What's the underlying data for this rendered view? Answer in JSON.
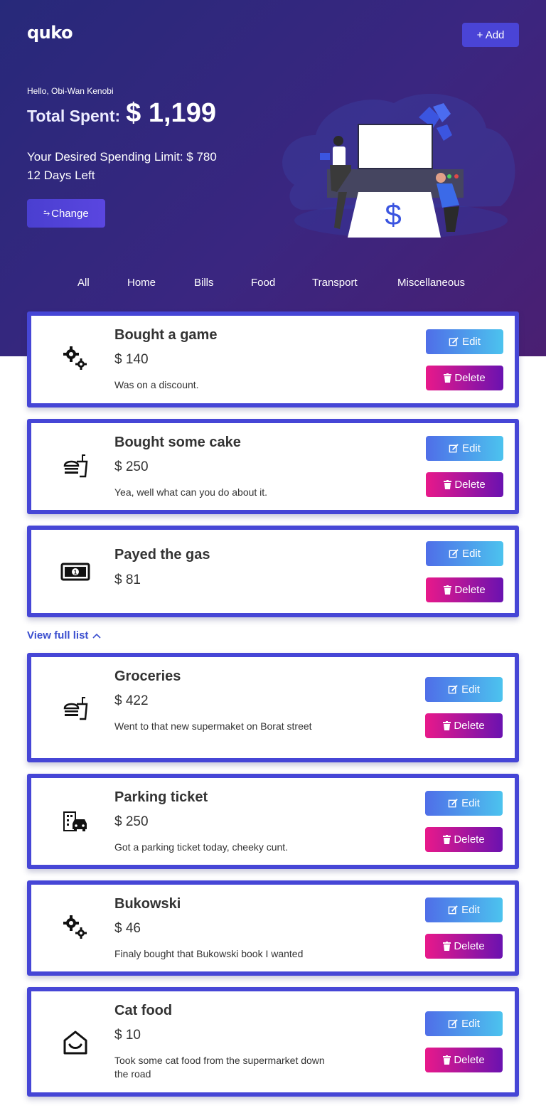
{
  "app": {
    "logo": "quko"
  },
  "header": {
    "add_label": "+ Add",
    "greeting": "Hello, Obi-Wan Kenobi",
    "total_label": "Total Spent:",
    "total_value": "$ 1,199",
    "limit_text": "Your Desired Spending Limit: $ 780",
    "days_left": "12 Days Left",
    "change_label": "Change",
    "illustration_symbol": "$"
  },
  "tabs": [
    "All",
    "Home",
    "Bills",
    "Food",
    "Transport",
    "Miscellaneous"
  ],
  "actions": {
    "edit_label": "Edit",
    "delete_label": "Delete"
  },
  "recent": [
    {
      "title": "Bought a game",
      "amount": "$ 140",
      "description": "Was on a discount.",
      "icon": "gears-icon"
    },
    {
      "title": "Bought some cake",
      "amount": "$ 250",
      "description": "Yea, well what can you do about it.",
      "icon": "food-icon"
    },
    {
      "title": "Payed the gas",
      "amount": "$ 81",
      "description": "",
      "icon": "money-bill-icon"
    }
  ],
  "view_full_label": "View full list",
  "full_list": [
    {
      "title": "Groceries",
      "amount": "$ 422",
      "description": "Went to that new supermaket on Borat street",
      "icon": "food-icon"
    },
    {
      "title": "Parking ticket",
      "amount": "$ 250",
      "description": "Got a parking ticket today, cheeky cunt.",
      "icon": "city-car-icon"
    },
    {
      "title": "Bukowski",
      "amount": "$ 46",
      "description": "Finaly bought that Bukowski book I wanted",
      "icon": "gears-icon"
    },
    {
      "title": "Cat food",
      "amount": "$ 10",
      "description": "Took some cat food from the supermarket down the road",
      "icon": "home-icon"
    }
  ],
  "colors": {
    "hero_start": "#27297a",
    "hero_end": "#4a1f72",
    "card_border": "#4646d6",
    "edit_gradient": [
      "#4f6ee8",
      "#4cc3ee"
    ],
    "delete_gradient": [
      "#e8198a",
      "#6a12b0"
    ],
    "link": "#3b4fcf"
  }
}
